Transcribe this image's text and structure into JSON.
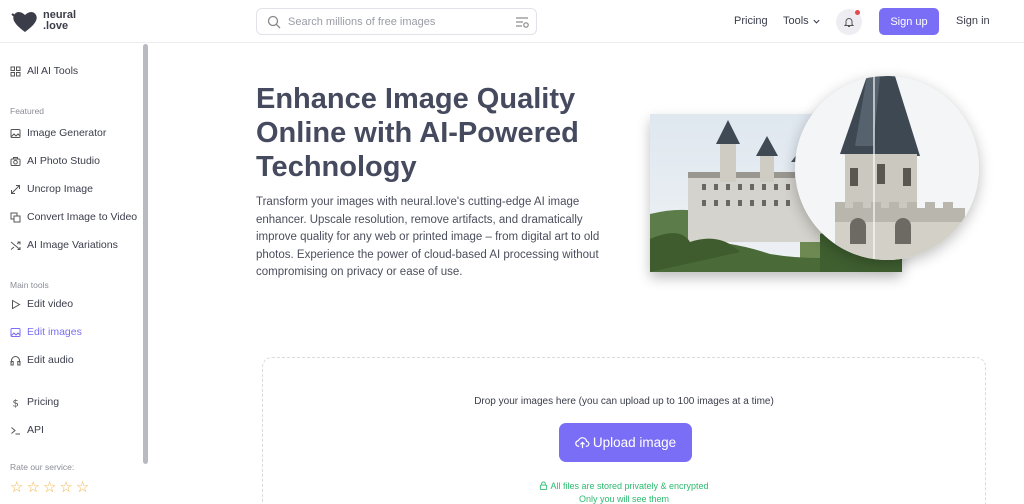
{
  "brand": {
    "line1": "neural",
    "line2": ".love"
  },
  "search": {
    "placeholder": "Search millions of free images"
  },
  "nav": {
    "pricing": "Pricing",
    "tools": "Tools",
    "signup": "Sign up",
    "signin": "Sign in"
  },
  "sidebar": {
    "all_tools": "All AI Tools",
    "featured_label": "Featured",
    "featured": [
      "Image Generator",
      "AI Photo Studio",
      "Uncrop Image",
      "Convert Image to Video",
      "AI Image Variations"
    ],
    "main_label": "Main tools",
    "main": [
      "Edit video",
      "Edit images",
      "Edit audio"
    ],
    "active_item": "Edit images",
    "pricing": "Pricing",
    "api": "API",
    "rate_label": "Rate our service:",
    "rating_stars": 5
  },
  "hero": {
    "title_line1": "Enhance Image Quality",
    "title_line2": "Online with AI-Powered",
    "title_line3": "Technology",
    "description": "Transform your images with neural.love's cutting-edge AI image enhancer. Upscale resolution, remove artifacts, and dramatically improve quality for any web or printed image – from digital art to old photos. Experience the power of cloud-based AI processing without compromising on privacy or ease of use."
  },
  "upload": {
    "hint": "Drop your images here (you can upload up to 100 images at a time)",
    "button": "Upload image",
    "privacy_line1": "All files are stored privately & encrypted",
    "privacy_line2": "Only you will see them"
  },
  "colors": {
    "accent": "#7b6ef6",
    "success": "#2dbb6f",
    "notification": "#e5484d",
    "star": "#f0b44a"
  }
}
